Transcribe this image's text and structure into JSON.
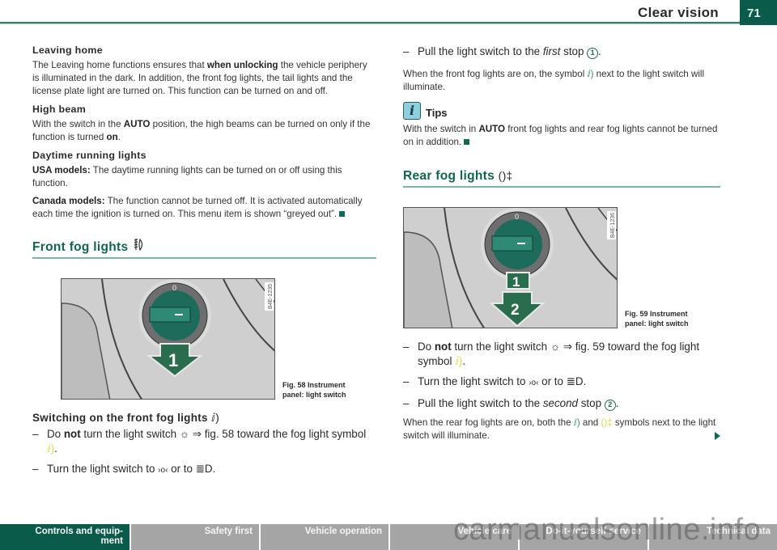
{
  "header": {
    "section_title": "Clear vision",
    "page_number": "71"
  },
  "left": {
    "leaving_home": {
      "heading": "Leaving home",
      "text_1": "The Leaving home functions ensures that ",
      "bold_1": "when unlocking",
      "text_2": " the vehicle periphery is illuminated in the dark. In addition, the front fog lights, the tail lights and the license plate light are turned on. This function can be turned on and off."
    },
    "high_beam": {
      "heading": "High beam",
      "text_1": "With the switch in the ",
      "bold_1": "AUTO",
      "text_2": " position, the high beams can be turned on only if the function is turned ",
      "bold_2": "on",
      "text_3": "."
    },
    "daytime": {
      "heading": "Daytime running lights",
      "usa_label": "USA models:",
      "usa_text": " The daytime running lights can be turned on or off using this function.",
      "canada_label": "Canada models:",
      "canada_text": " The function cannot be turned off. It is activated automatically each time the ignition is turned on. This menu item is shown “greyed out”."
    },
    "front_fog": {
      "heading": "Front fog lights",
      "heading_symbol": "front-fog-light-symbol",
      "figure": {
        "code": "B4E-1235",
        "caption_1": "Fig. 58  Instrument",
        "caption_2": "panel: light switch",
        "arrow_label": "1"
      },
      "subheading": "Switching on the front fog lights",
      "steps": [
        {
          "pre": "Do ",
          "bold": "not",
          "post": " turn the light switch ",
          "ref": "⇒ fig. 58 toward the fog light symbol",
          "end": "."
        },
        {
          "text": "Turn the light switch to ",
          "or": " or to ",
          "end": "."
        }
      ]
    }
  },
  "right": {
    "step_first": {
      "pre": "Pull the light switch to the ",
      "ital": "first",
      "post": " stop ",
      "num": "1",
      "end": "."
    },
    "front_fog_note": {
      "pre": "When the front fog lights are on, the symbol ",
      "post": " next to the light switch will illuminate."
    },
    "tips": {
      "label": "Tips",
      "text_1": "With the switch in ",
      "bold": "AUTO",
      "text_2": " front fog lights and rear fog lights cannot be turned on in addition."
    },
    "rear_fog": {
      "heading": "Rear fog lights",
      "figure": {
        "code": "B4E-1236",
        "caption_1": "Fig. 59  Instrument",
        "caption_2": "panel: light switch",
        "arrow_label_1": "1",
        "arrow_label_2": "2"
      },
      "steps": [
        {
          "pre": "Do ",
          "bold": "not",
          "post": " turn the light switch ",
          "ref": "⇒ fig. 59 toward the fog light symbol",
          "end": "."
        },
        {
          "text": "Turn the light switch to ",
          "or": " or to ",
          "end": "."
        },
        {
          "pre": "Pull the light switch to the ",
          "ital": "second",
          "post": " stop ",
          "num": "2",
          "end": "."
        }
      ],
      "note_pre": "When the rear fog lights are on, both the ",
      "note_and": " and ",
      "note_post": " symbols next to the light switch will illuminate."
    }
  },
  "footer": {
    "tabs": [
      {
        "label": "Controls and equip-ment",
        "line1": "Controls and equip-",
        "line2": "ment",
        "active": true
      },
      {
        "label": "Safety first",
        "active": false
      },
      {
        "label": "Vehicle operation",
        "active": false
      },
      {
        "label": "Vehicle care",
        "active": false
      },
      {
        "label": "Do-it-yourself service",
        "active": false
      },
      {
        "label": "Technical data",
        "active": false
      }
    ],
    "watermark": "carmanualsonline.info"
  },
  "symbols": {
    "front_fog": "ꜰ⸽",
    "rear_fog": "0‡",
    "light_switch_sun": "☼",
    "parking_lights": "›o‹",
    "low_beam": "≡D"
  },
  "colors": {
    "brand_green": "#0b5b4b",
    "heading_green": "#0e6651",
    "tab_grey": "#a5a5a5",
    "symbol_green": "#2f8f6c",
    "symbol_yellow": "#e6d840"
  }
}
